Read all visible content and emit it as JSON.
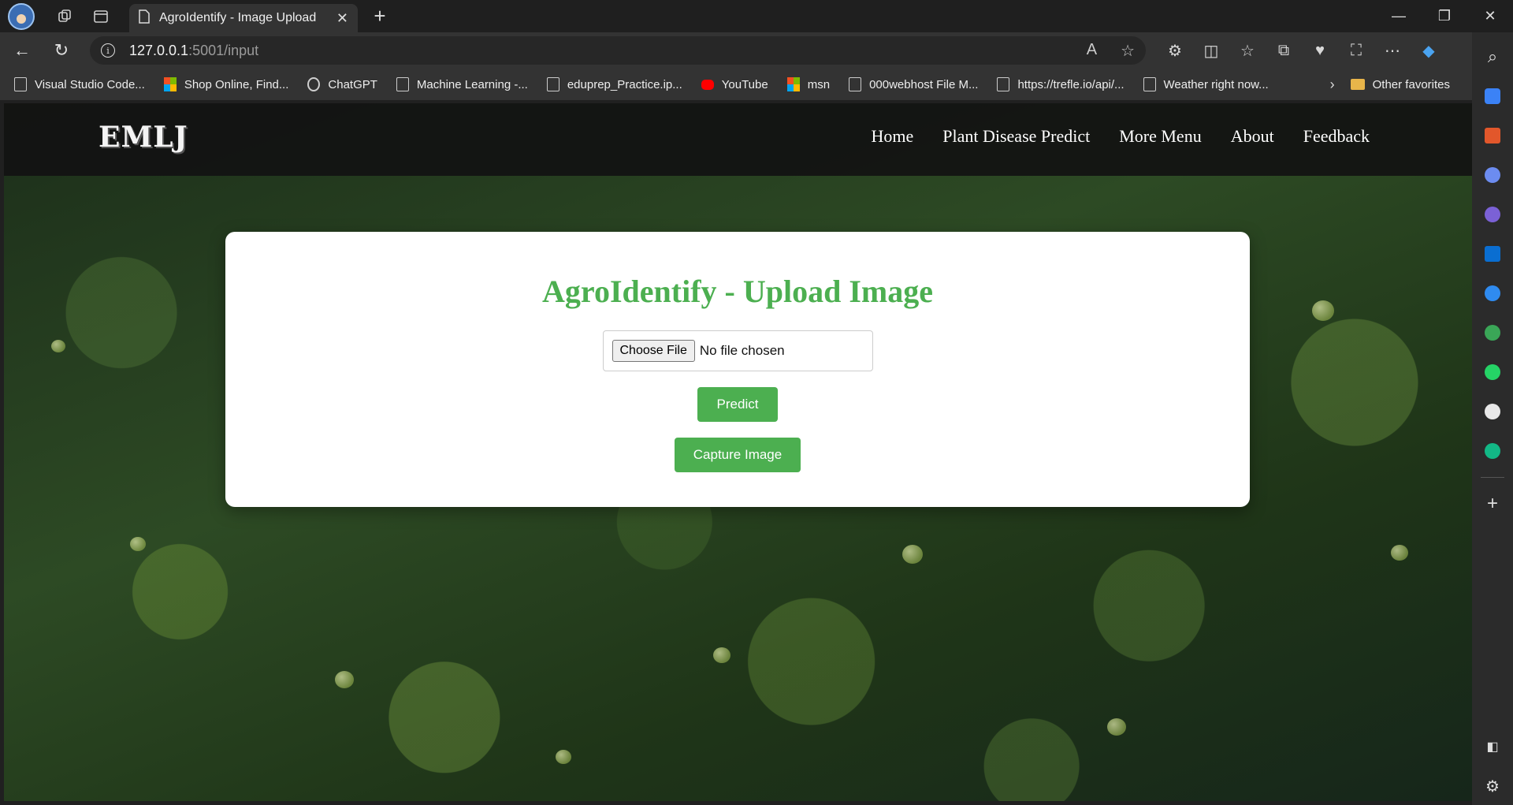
{
  "browser": {
    "tab_title": "AgroIdentify - Image Upload",
    "url_host": "127.0.0.1",
    "url_path": ":5001/input",
    "bookmarks": [
      {
        "label": "Visual Studio Code...",
        "icon": "doc"
      },
      {
        "label": "Shop Online, Find...",
        "icon": "ms"
      },
      {
        "label": "ChatGPT",
        "icon": "gpt"
      },
      {
        "label": "Machine Learning -...",
        "icon": "doc"
      },
      {
        "label": "eduprep_Practice.ip...",
        "icon": "doc"
      },
      {
        "label": "YouTube",
        "icon": "yt"
      },
      {
        "label": "msn",
        "icon": "ms"
      },
      {
        "label": "000webhost File M...",
        "icon": "doc"
      },
      {
        "label": "https://trefle.io/api/...",
        "icon": "doc"
      },
      {
        "label": "Weather right now...",
        "icon": "doc"
      }
    ],
    "other_favorites": "Other favorites"
  },
  "site": {
    "logo": "EMLJ",
    "menu": [
      "Home",
      "Plant Disease Predict",
      "More Menu",
      "About",
      "Feedback"
    ],
    "heading": "AgroIdentify - Upload Image",
    "file_button": "Choose File",
    "file_status": "No file chosen",
    "predict_label": "Predict",
    "capture_label": "Capture Image",
    "accent_color": "#4caf50"
  }
}
